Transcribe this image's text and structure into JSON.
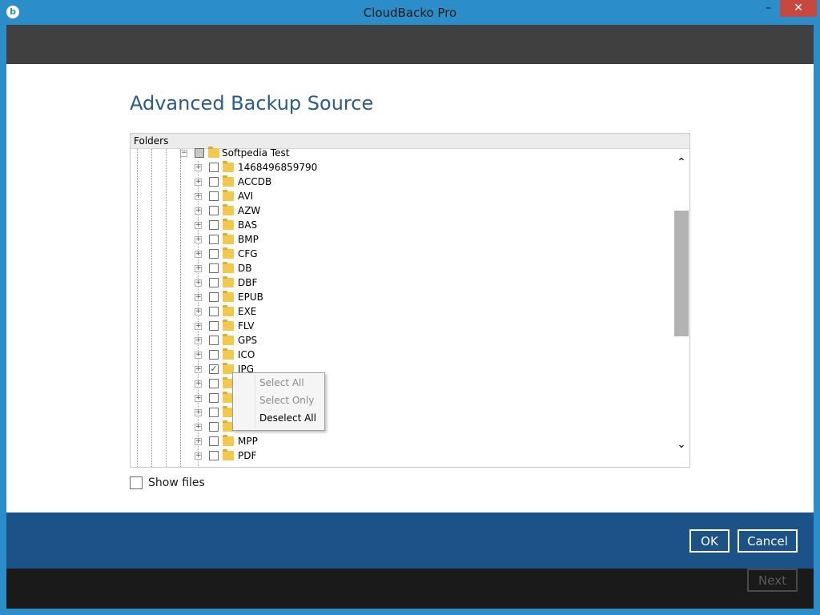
{
  "window": {
    "title": "CloudBacko Pro",
    "min_glyph": "–",
    "close_glyph": "✕",
    "app_icon_glyph": "b"
  },
  "page": {
    "title": "Advanced Backup Source"
  },
  "tree": {
    "header": "Folders",
    "expand_glyph": "+",
    "collapse_glyph": "−",
    "check_glyph": "✓",
    "root": {
      "label": "Softpedia Test",
      "state": "partial"
    },
    "items": [
      {
        "label": "1468496859790",
        "checked": false
      },
      {
        "label": "ACCDB",
        "checked": false
      },
      {
        "label": "AVI",
        "checked": false
      },
      {
        "label": "AZW",
        "checked": false
      },
      {
        "label": "BAS",
        "checked": false
      },
      {
        "label": "BMP",
        "checked": false
      },
      {
        "label": "CFG",
        "checked": false
      },
      {
        "label": "DB",
        "checked": false
      },
      {
        "label": "DBF",
        "checked": false
      },
      {
        "label": "EPUB",
        "checked": false
      },
      {
        "label": "EXE",
        "checked": false
      },
      {
        "label": "FLV",
        "checked": false
      },
      {
        "label": "GPS",
        "checked": false
      },
      {
        "label": "ICO",
        "checked": false
      },
      {
        "label": "JPG",
        "checked": true
      },
      {
        "label": "",
        "checked": false
      },
      {
        "label": "",
        "checked": false
      },
      {
        "label": "",
        "checked": false
      },
      {
        "label": "",
        "checked": false
      },
      {
        "label": "MPP",
        "checked": false
      },
      {
        "label": "PDF",
        "checked": false
      }
    ],
    "scroll_up_glyph": "⌃",
    "scroll_down_glyph": "⌄"
  },
  "context_menu": {
    "items": [
      {
        "label": "Select All",
        "enabled": false
      },
      {
        "label": "Select Only",
        "enabled": false
      },
      {
        "label": "Deselect All",
        "enabled": true
      }
    ]
  },
  "show_files": {
    "label": "Show files",
    "checked": false
  },
  "buttons": {
    "ok": "OK",
    "cancel": "Cancel",
    "next": "Next"
  },
  "colors": {
    "titlebar": "#2b8ec8",
    "header_bar": "#404040",
    "page_title": "#2a5b8c",
    "button_bar": "#1b5287",
    "footer_bar": "#1a1a1a",
    "close_button": "#c7483f"
  }
}
